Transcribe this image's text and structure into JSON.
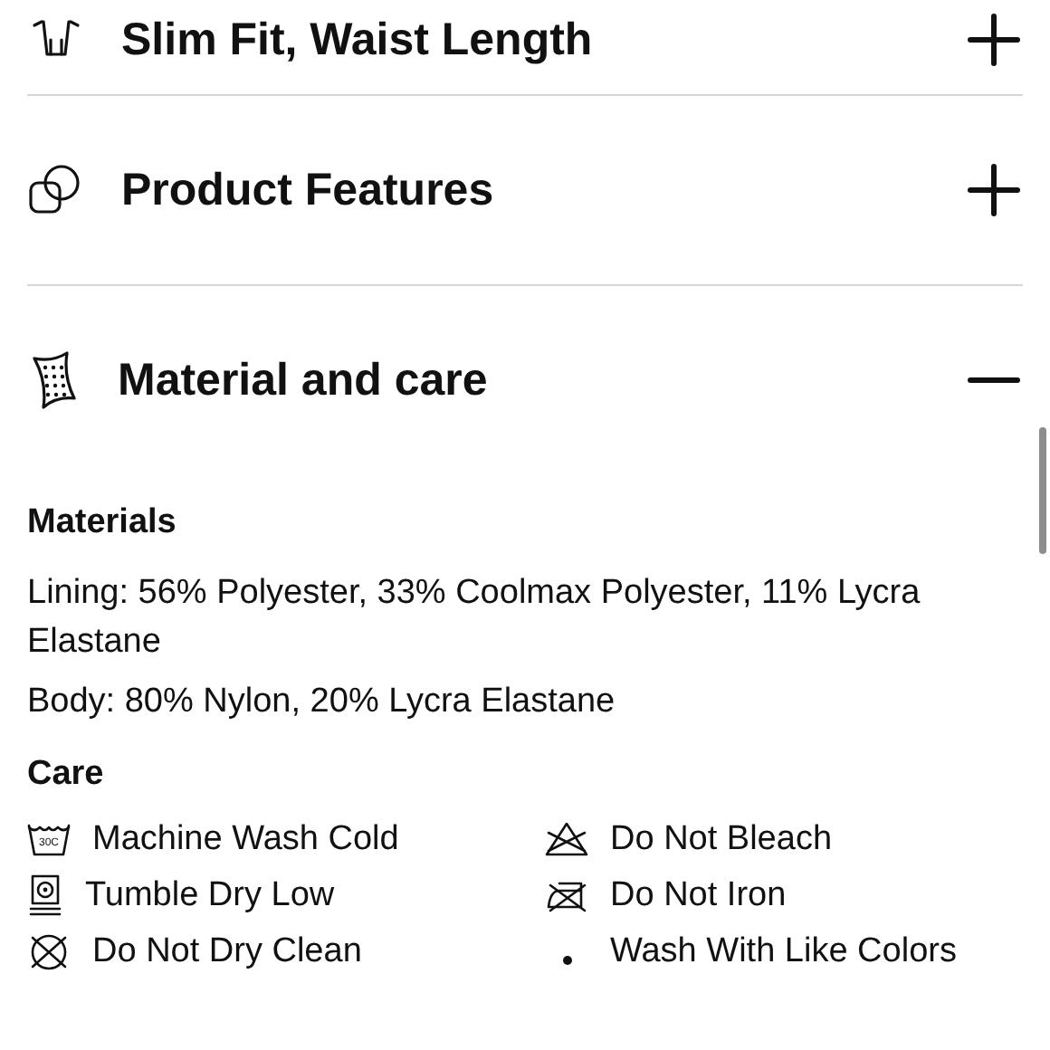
{
  "sections": [
    {
      "kind": "fit",
      "title": "Slim Fit, Waist Length",
      "expanded": false
    },
    {
      "kind": "features",
      "title": "Product Features",
      "expanded": false
    },
    {
      "kind": "material",
      "title": "Material and care",
      "expanded": true,
      "materials": {
        "heading": "Materials",
        "lines": [
          "Lining: 56% Polyester, 33% Coolmax Polyester, 11% Lycra Elastane",
          "Body: 80% Nylon, 20% Lycra Elastane"
        ]
      },
      "care": {
        "heading": "Care",
        "items": [
          {
            "kind": "wash",
            "label": "Machine Wash Cold",
            "icon_text": "30C"
          },
          {
            "kind": "no-bleach",
            "label": "Do Not Bleach"
          },
          {
            "kind": "tumble",
            "label": "Tumble Dry Low"
          },
          {
            "kind": "no-iron",
            "label": "Do Not Iron"
          },
          {
            "kind": "no-dryclean",
            "label": "Do Not Dry Clean"
          },
          {
            "kind": "dot",
            "label": "Wash With Like Colors"
          }
        ]
      }
    }
  ]
}
